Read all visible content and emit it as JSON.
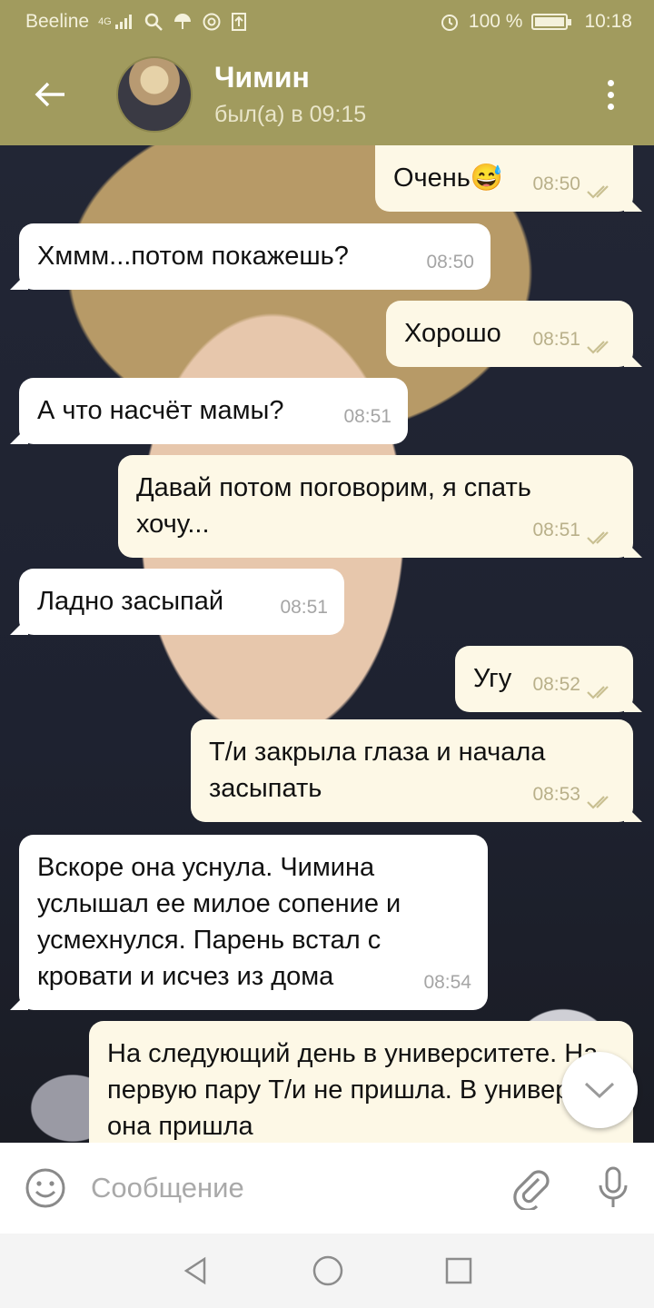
{
  "status_bar": {
    "carrier": "Beeline",
    "network": "4G",
    "battery": "100 %",
    "time": "10:18"
  },
  "header": {
    "name": "Чимин",
    "last_seen": "был(а) в 09:15"
  },
  "messages": [
    {
      "text": "Очень😅",
      "time": "08:50",
      "direction": "out"
    },
    {
      "text": "Хммм...потом покажешь?",
      "time": "08:50",
      "direction": "in"
    },
    {
      "text": "Хорошо",
      "time": "08:51",
      "direction": "out"
    },
    {
      "text": "А что насчёт мамы?",
      "time": "08:51",
      "direction": "in"
    },
    {
      "text": "Давай потом поговорим, я спать хочу...",
      "time": "08:51",
      "direction": "out"
    },
    {
      "text": "Ладно засыпай",
      "time": "08:51",
      "direction": "in"
    },
    {
      "text": "Угу",
      "time": "08:52",
      "direction": "out"
    },
    {
      "text": "Т/и закрыла глаза и начала засыпать",
      "time": "08:53",
      "direction": "out"
    },
    {
      "text": "Вскоре она уснула. Чимина услышал ее милое сопение и усмехнулся. Парень встал с кровати и исчез из дома",
      "time": "08:54",
      "direction": "in"
    },
    {
      "text": "На следующий день в университете. На первую пару Т/и не пришла. В универ она пришла",
      "time": "",
      "direction": "out"
    }
  ],
  "input": {
    "placeholder": "Сообщение"
  },
  "colors": {
    "header": "#a19b5e",
    "bubble_in": "#ffffff",
    "bubble_out": "#fdf8e6",
    "tick": "#b9b08a"
  },
  "icons": [
    "back-arrow-icon",
    "more-vert-icon",
    "emoji-icon",
    "attach-icon",
    "mic-icon",
    "chevron-down-icon",
    "nav-back-icon",
    "nav-home-icon",
    "nav-recents-icon"
  ]
}
